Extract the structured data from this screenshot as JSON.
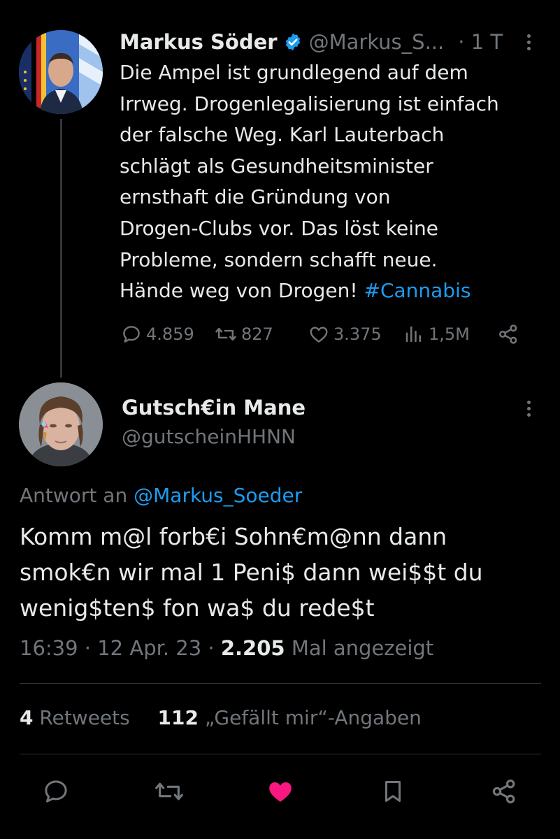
{
  "parent_tweet": {
    "author_name": "Markus Söder",
    "handle": "@Markus_S...",
    "time": "· 1 T",
    "text_lines": [
      "Die Ampel ist grundlegend auf dem",
      "Irrweg. Drogenlegalisierung ist einfach",
      "der falsche Weg. Karl Lauterbach",
      "schlägt als Gesundheitsminister",
      "ernsthaft die Gründung von",
      "Drogen-Clubs vor. Das löst keine",
      "Probleme, sondern schafft neue.",
      "Hände weg von Drogen!"
    ],
    "hashtag": "#Cannabis",
    "replies": "4.859",
    "retweets": "827",
    "likes": "3.375",
    "views": "1,5M"
  },
  "reply_tweet": {
    "author_name": "Gutsch€in Mane",
    "handle": "@gutscheinHHNN",
    "reply_to_label": "Antwort an",
    "reply_to_mention": "@Markus_Soeder",
    "text_lines": [
      "Komm m@l forb€i Sohn€m@nn dann",
      "smok€n wir mal 1 Peni$ dann wei$$t du",
      "wenig$ten$ fon wa$ du rede$t"
    ],
    "time": "16:39",
    "date": "12 Apr. 23",
    "view_count": "2.205",
    "view_label": "Mal angezeigt",
    "retweet_count": "4",
    "retweet_label": "Retweets",
    "like_count": "112",
    "like_label": "„Gefällt mir“-Angaben"
  },
  "colors": {
    "background": "#000000",
    "text": "#e7e9ea",
    "muted": "#71767b",
    "link": "#1d9bf0",
    "like_active": "#f91880",
    "divider": "#2f3336"
  },
  "icons": [
    "verified-badge-icon",
    "more-icon",
    "reply-icon",
    "retweet-icon",
    "like-icon",
    "views-icon",
    "share-icon",
    "bookmark-icon"
  ]
}
